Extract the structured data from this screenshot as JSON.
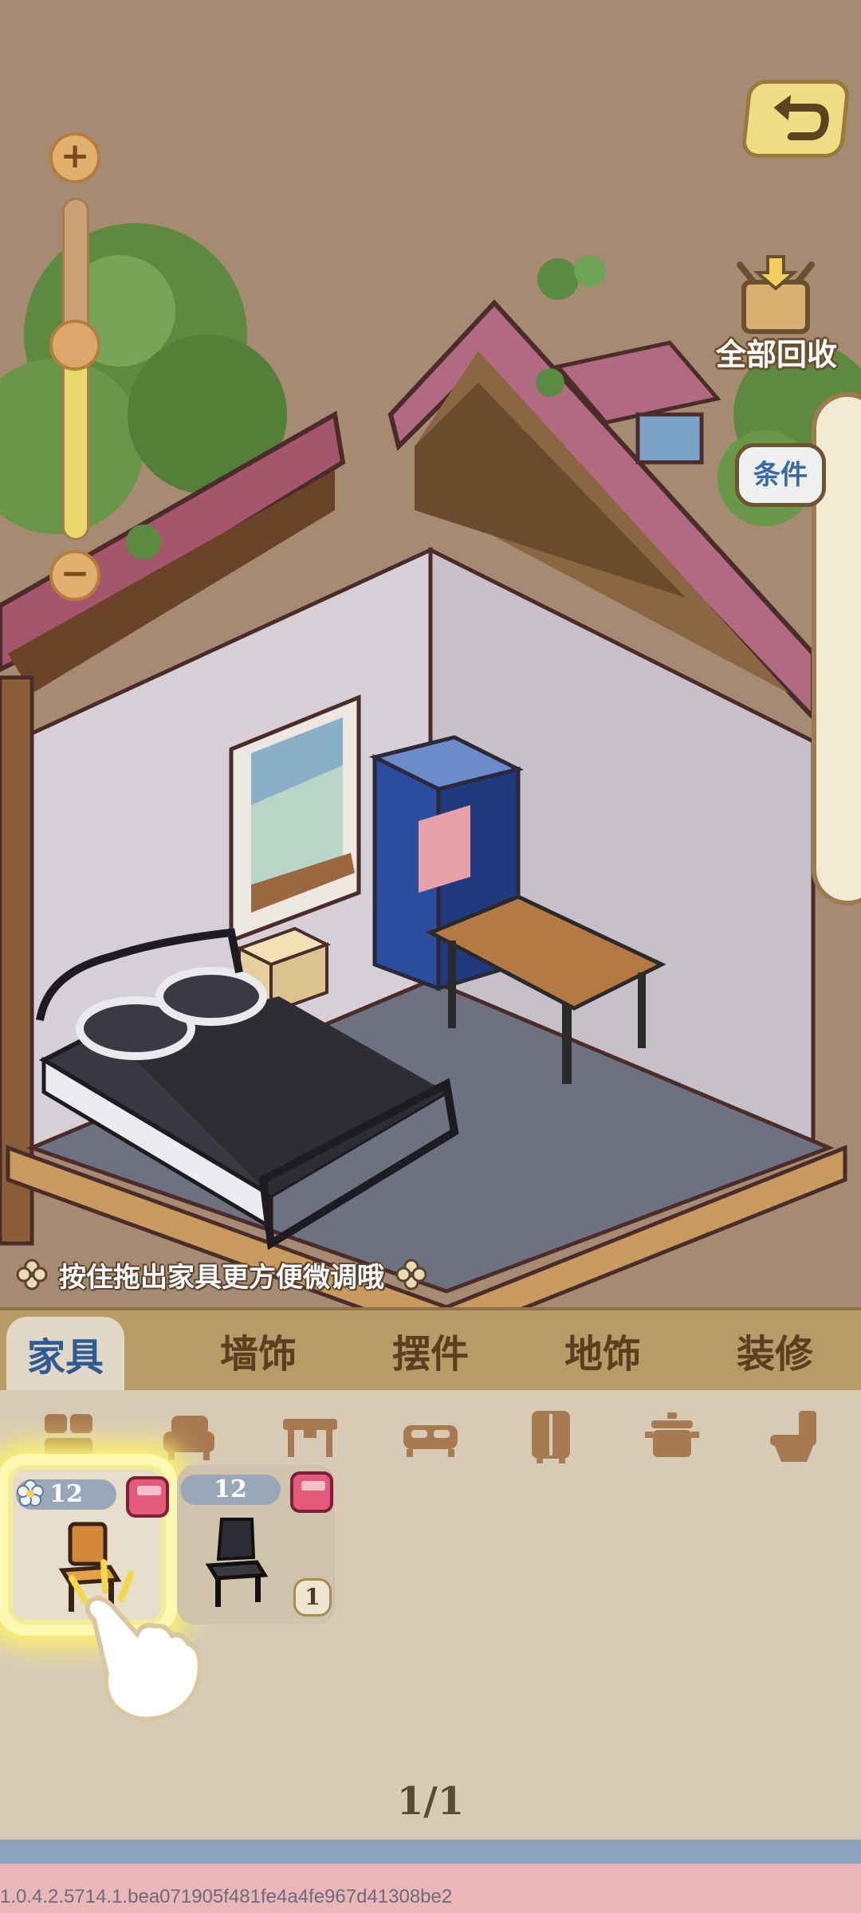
{
  "hud": {
    "zoom_plus": "+",
    "zoom_minus": "−",
    "zoom_level": 0.57,
    "recycle_all_label": "全部回收",
    "conditions_label": "条件",
    "hint_text": "按住拖出家具更方便微调哦"
  },
  "tabs": [
    {
      "label": "家具",
      "active": true
    },
    {
      "label": "墙饰",
      "active": false
    },
    {
      "label": "摆件",
      "active": false
    },
    {
      "label": "地饰",
      "active": false
    },
    {
      "label": "装修",
      "active": false
    }
  ],
  "category_icons": [
    "chair-category-icon",
    "sofa-category-icon",
    "table-category-icon",
    "bed-category-icon",
    "wardrobe-category-icon",
    "pot-category-icon",
    "toilet-category-icon"
  ],
  "items": [
    {
      "name": "wooden chair",
      "count_badge": "12",
      "highlighted": true,
      "owned": ""
    },
    {
      "name": "black chair",
      "count_badge": "12",
      "highlighted": false,
      "owned": "1"
    }
  ],
  "pagination": "1/1",
  "footer": {
    "version": "1.0.4.2.5714.1.bea071905f481fe4a4fe967d41308be2"
  },
  "colors": {
    "active_tab_text": "#2f5b95",
    "tab_bar": "#b79c66",
    "panel_bg": "#d8cbb6",
    "highlight_glow": "#fbef6e"
  }
}
